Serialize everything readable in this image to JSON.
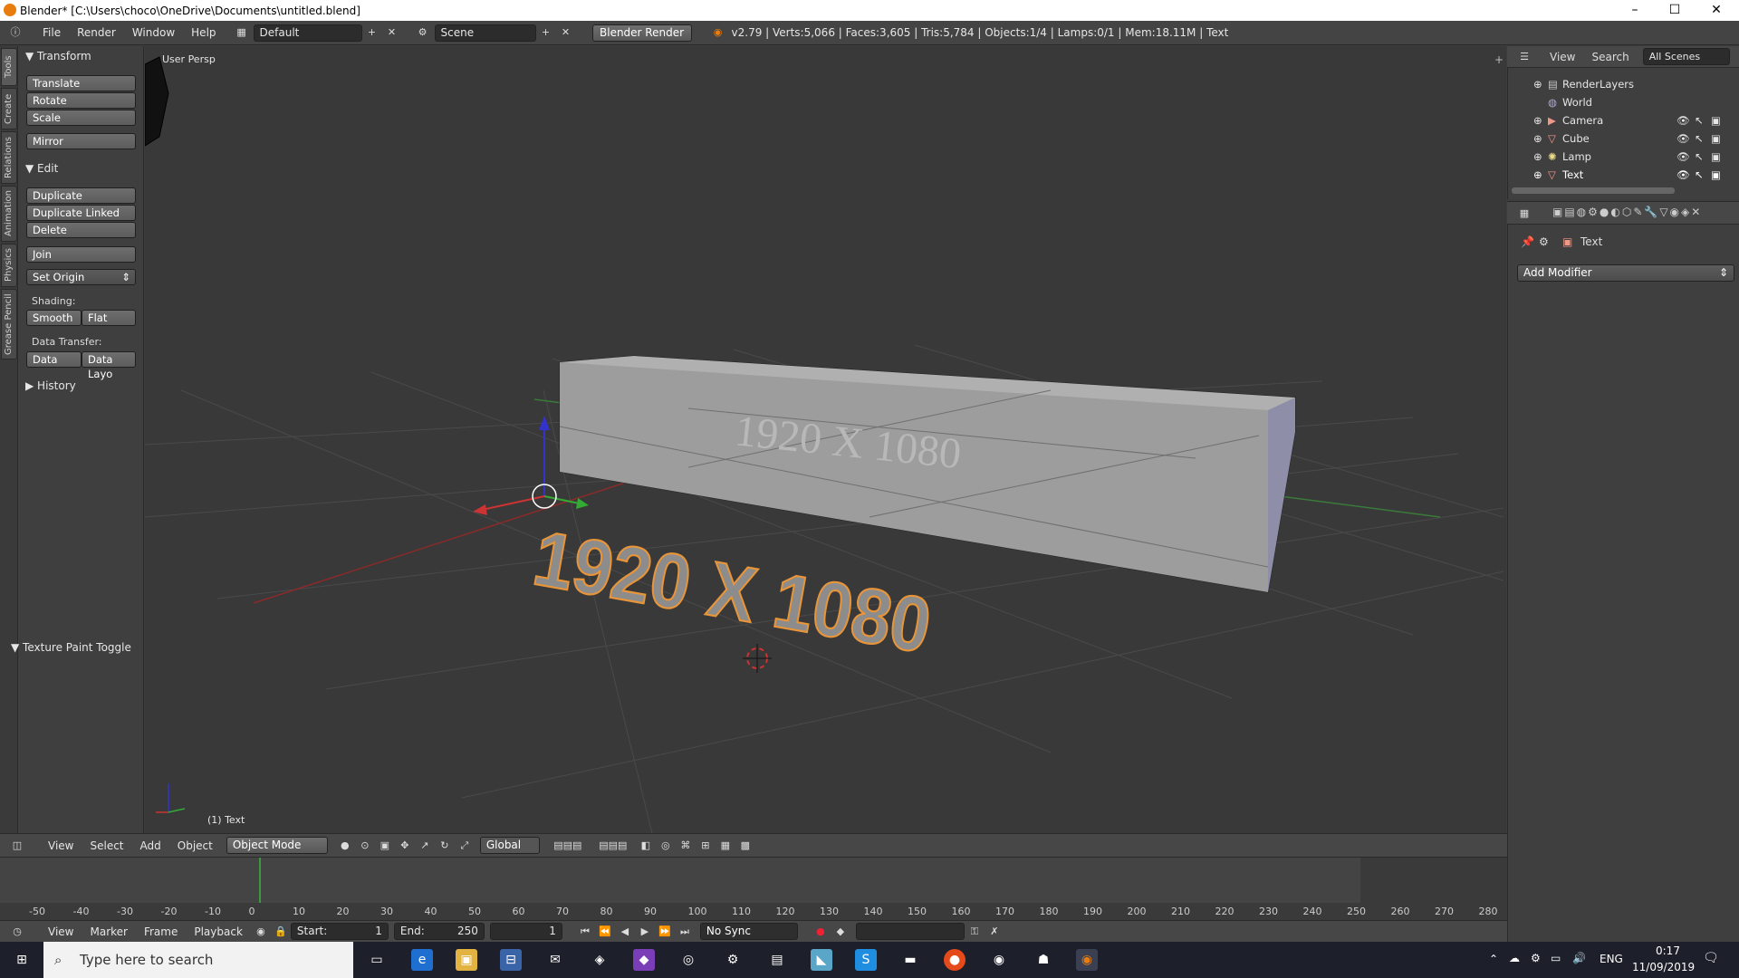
{
  "window": {
    "title": "Blender* [C:\\Users\\choco\\OneDrive\\Documents\\untitled.blend]",
    "controls": [
      "–",
      "☐",
      "✕"
    ]
  },
  "info_header": {
    "menus": [
      "File",
      "Render",
      "Window",
      "Help"
    ],
    "layout": "Default",
    "scene": "Scene",
    "engine": "Blender Render",
    "stats": "v2.79 | Verts:5,066 | Faces:3,605 | Tris:5,784 | Objects:1/4 | Lamps:0/1 | Mem:18.11M | Text"
  },
  "tool_tabs": [
    "Tools",
    "Create",
    "Relations",
    "Animation",
    "Physics",
    "Grease Pencil"
  ],
  "tool_shelf": {
    "transform_header": "Transform",
    "transform_buttons": [
      "Translate",
      "Rotate",
      "Scale"
    ],
    "mirror": "Mirror",
    "edit_header": "Edit",
    "edit_buttons": [
      "Duplicate",
      "Duplicate Linked",
      "Delete"
    ],
    "join": "Join",
    "set_origin": "Set Origin",
    "shading_label": "Shading:",
    "smooth": "Smooth",
    "flat": "Flat",
    "data_transfer_label": "Data Transfer:",
    "data": "Data",
    "data_layout": "Data Layo",
    "history": "History",
    "texture_paint": "Texture Paint Toggle"
  },
  "viewport": {
    "view_label": "User Persp",
    "object_label": "(1) Text",
    "text_3d": "1920 X 1080"
  },
  "viewport_header": {
    "menus": [
      "View",
      "Select",
      "Add",
      "Object"
    ],
    "mode": "Object Mode",
    "orientation": "Global"
  },
  "timeline": {
    "ticks": [
      "-50",
      "-40",
      "-30",
      "-20",
      "-10",
      "0",
      "10",
      "20",
      "30",
      "40",
      "50",
      "60",
      "70",
      "80",
      "90",
      "100",
      "110",
      "120",
      "130",
      "140",
      "150",
      "160",
      "170",
      "180",
      "190",
      "200",
      "210",
      "220",
      "230",
      "240",
      "250",
      "260",
      "270",
      "280"
    ],
    "current_frame": 1,
    "menus": [
      "View",
      "Marker",
      "Frame",
      "Playback"
    ],
    "start_label": "Start:",
    "start_value": "1",
    "end_label": "End:",
    "end_value": "250",
    "frame_value": "1",
    "sync": "No Sync"
  },
  "outliner": {
    "menus": [
      "View",
      "Search"
    ],
    "scenes": "All Scenes",
    "items": [
      {
        "name": "RenderLayers"
      },
      {
        "name": "World"
      },
      {
        "name": "Camera"
      },
      {
        "name": "Cube"
      },
      {
        "name": "Lamp"
      },
      {
        "name": "Text"
      }
    ]
  },
  "properties": {
    "object_name": "Text",
    "add_modifier": "Add Modifier"
  },
  "taskbar": {
    "search_placeholder": "Type here to search",
    "lang": "ENG",
    "time": "0:17",
    "date": "11/09/2019"
  },
  "colors": {
    "selection_orange": "#e8953a",
    "x_axis": "#c33",
    "y_axis": "#3a3",
    "z_axis": "#33c"
  }
}
